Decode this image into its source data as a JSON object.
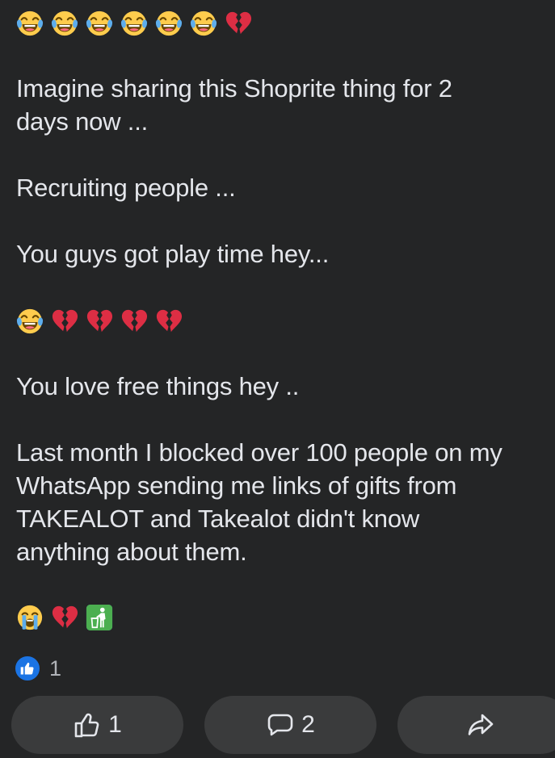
{
  "post": {
    "emoji_lines": {
      "line1": [
        "joy",
        "joy",
        "joy",
        "joy",
        "joy",
        "joy",
        "broken-heart"
      ],
      "line2": [
        "joy",
        "broken-heart",
        "broken-heart",
        "broken-heart",
        "broken-heart"
      ],
      "line3": [
        "loudly-crying",
        "broken-heart",
        "put-litter-in-bin"
      ]
    },
    "paragraphs": {
      "p1": "Imagine sharing this Shoprite thing for 2\ndays now ...",
      "p2": "Recruiting people ...",
      "p3": "You guys got play time hey...",
      "p4": "You love free things hey ..",
      "p5": "Last month I blocked over 100 people on my\nWhatsApp sending me links of gifts from\nTAKEALOT and Takealot didn't know\nanything about them."
    }
  },
  "reactions": {
    "icon": "like-icon",
    "count": "1"
  },
  "actions": {
    "like_count": "1",
    "comment_count": "2",
    "like_icon": "thumbs-up-outline-icon",
    "comment_icon": "comment-bubble-icon",
    "share_icon": "share-arrow-icon"
  },
  "colors": {
    "background": "#242526",
    "text": "#e4e6eb",
    "button_bg": "#3a3b3c",
    "like_blue": "#1b74e4"
  }
}
